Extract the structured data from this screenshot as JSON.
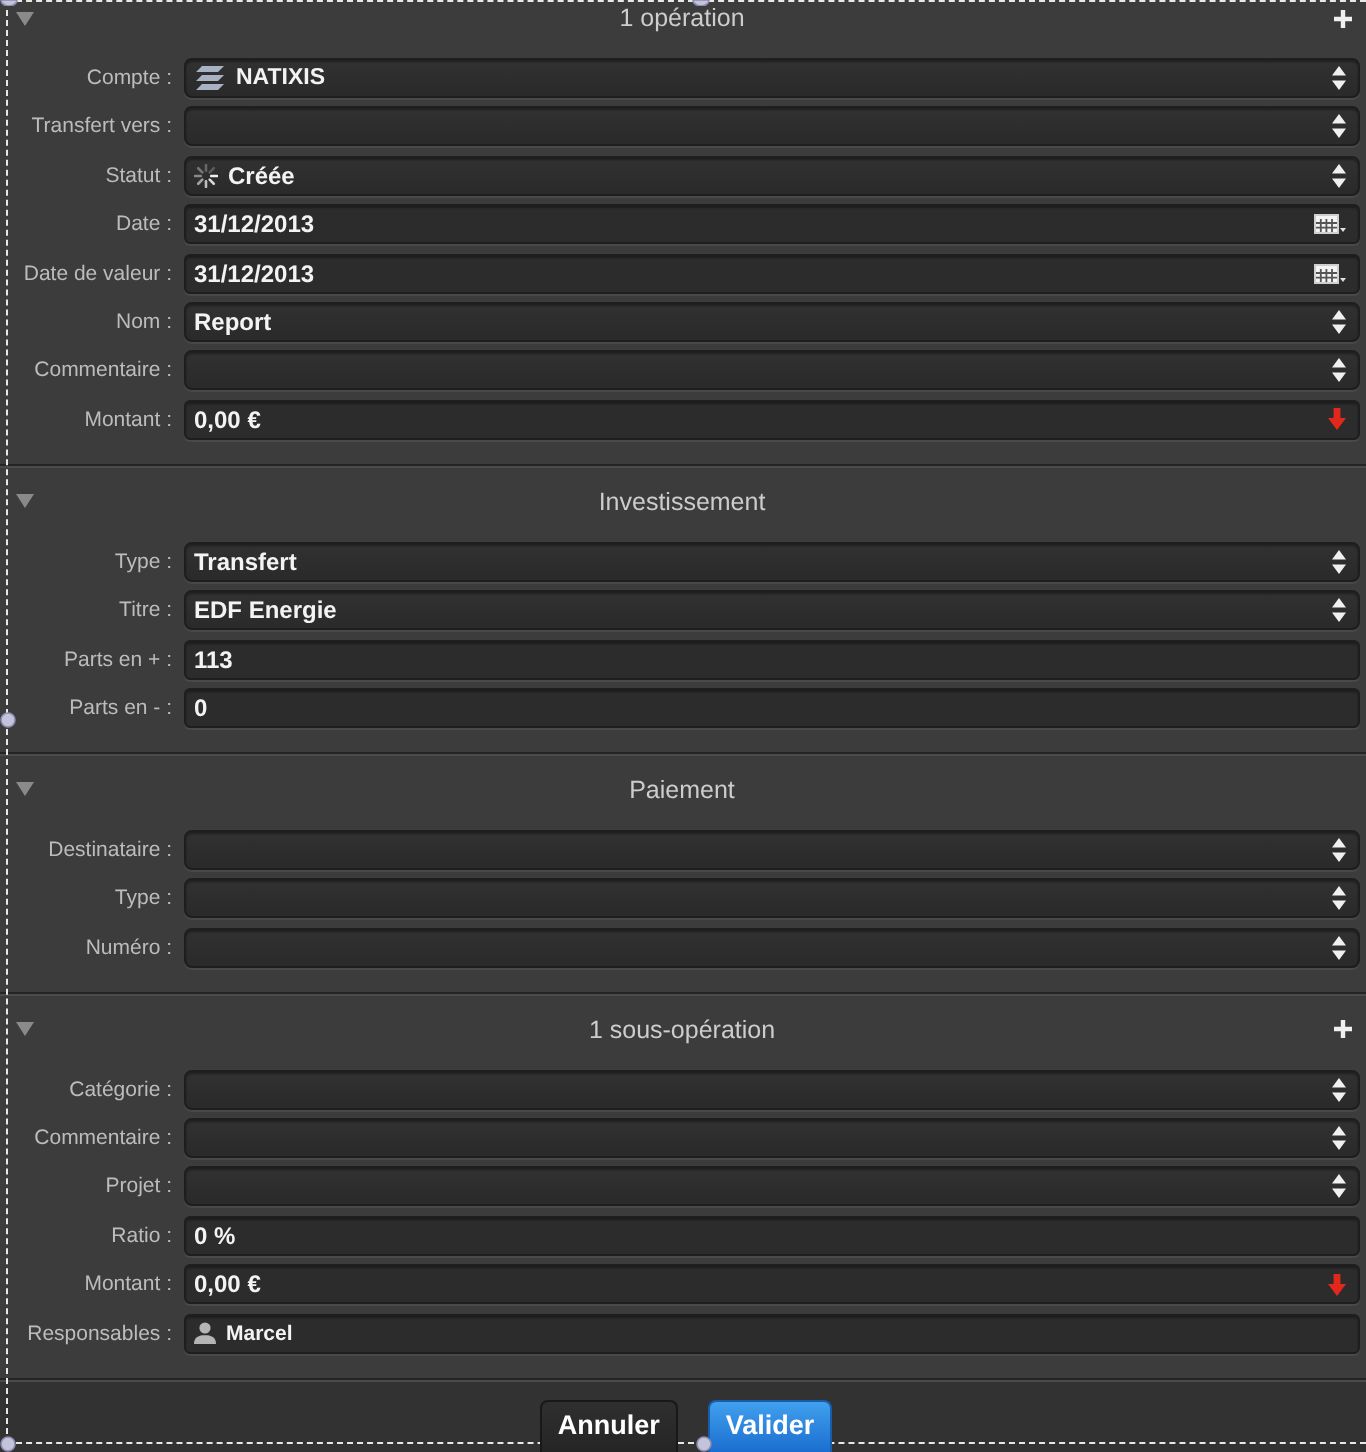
{
  "sections": [
    {
      "title": "1 opération",
      "expanded": true,
      "add": true,
      "fields": [
        {
          "label": "Compte :",
          "kind": "account",
          "value": "NATIXIS"
        },
        {
          "label": "Transfert vers :",
          "kind": "select"
        },
        {
          "label": "Statut :",
          "kind": "status",
          "value": "Créée"
        },
        {
          "label": "Date :",
          "kind": "date",
          "value": "31/12/2013"
        },
        {
          "label": "Date de valeur :",
          "kind": "date",
          "value": "31/12/2013"
        },
        {
          "label": "Nom :",
          "kind": "select",
          "value": "Report"
        },
        {
          "label": "Commentaire :",
          "kind": "select"
        },
        {
          "label": "Montant :",
          "kind": "amount",
          "value": "0,00 €"
        }
      ]
    },
    {
      "title": "Investissement",
      "expanded": true,
      "fields": [
        {
          "label": "Type :",
          "kind": "select",
          "value": "Transfert"
        },
        {
          "label": "Titre :",
          "kind": "select",
          "value": "EDF Energie"
        },
        {
          "label": "Parts en + :",
          "kind": "text",
          "value": "113"
        },
        {
          "label": "Parts en - :",
          "kind": "text",
          "value": "0"
        }
      ]
    },
    {
      "title": "Paiement",
      "expanded": true,
      "fields": [
        {
          "label": "Destinataire :",
          "kind": "select"
        },
        {
          "label": "Type :",
          "kind": "select"
        },
        {
          "label": "Numéro :",
          "kind": "select"
        }
      ]
    },
    {
      "title": "1 sous-opération",
      "expanded": true,
      "add": true,
      "fields": [
        {
          "label": "Catégorie :",
          "kind": "select"
        },
        {
          "label": "Commentaire :",
          "kind": "select"
        },
        {
          "label": "Projet :",
          "kind": "select"
        },
        {
          "label": "Ratio :",
          "kind": "text",
          "value": "0 %"
        },
        {
          "label": "Montant :",
          "kind": "amount",
          "value": "0,00 €"
        },
        {
          "label": "Responsables :",
          "kind": "person",
          "value": "Marcel"
        }
      ]
    }
  ],
  "buttons": [
    {
      "label": "Annuler",
      "kind": "cancel"
    },
    {
      "label": "Valider",
      "kind": "default"
    }
  ]
}
